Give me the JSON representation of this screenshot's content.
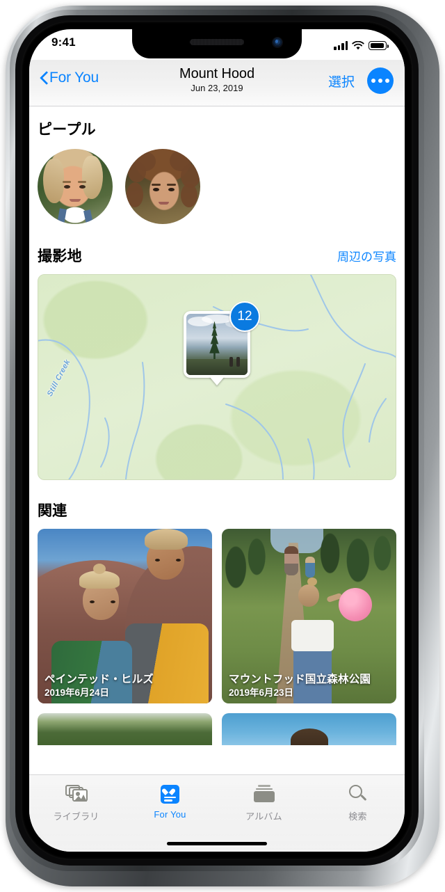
{
  "status_bar": {
    "time": "9:41",
    "signal_icon": "cellular-signal-icon",
    "wifi_icon": "wifi-icon",
    "battery_icon": "battery-icon"
  },
  "nav": {
    "back_label": "For You",
    "back_icon": "chevron-left-icon",
    "title": "Mount Hood",
    "subtitle": "Jun 23, 2019",
    "select_label": "選択",
    "more_icon": "ellipsis-icon"
  },
  "sections": {
    "people": {
      "title": "ピープル",
      "faces": [
        {
          "name": "face-thumbnail-1"
        },
        {
          "name": "face-thumbnail-2"
        }
      ]
    },
    "places": {
      "title": "撮影地",
      "action_label": "周辺の写真",
      "map": {
        "creek_label": "Still Creek",
        "pin_badge_count": "12",
        "pin_photo_name": "mountain-tree-photo"
      }
    },
    "related": {
      "title": "関連",
      "cards": [
        {
          "title": "ペインテッド・ヒルズ",
          "date": "2019年6月24日"
        },
        {
          "title": "マウントフッド国立森林公園",
          "date": "2019年6月23日"
        }
      ]
    }
  },
  "tabbar": {
    "tabs": [
      {
        "label": "ライブラリ",
        "icon": "photos-library-icon",
        "active": false
      },
      {
        "label": "For You",
        "icon": "for-you-heart-icon",
        "active": true
      },
      {
        "label": "アルバム",
        "icon": "albums-icon",
        "active": false
      },
      {
        "label": "検索",
        "icon": "search-icon",
        "active": false
      }
    ]
  },
  "colors": {
    "accent": "#0a84ff",
    "map_green": "#dfeccb",
    "creek_blue": "#6aa3d8",
    "tab_inactive": "#8d8d92"
  }
}
